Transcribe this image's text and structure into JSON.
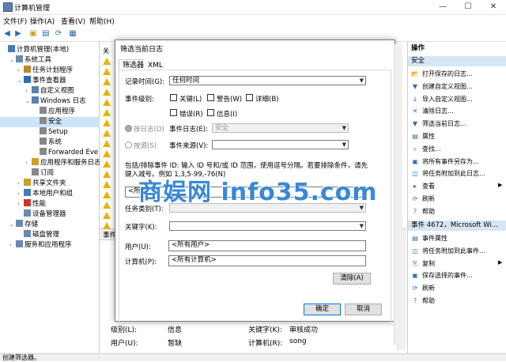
{
  "window": {
    "title": "计算机管理",
    "min": "—",
    "max": "☐",
    "close": "✕"
  },
  "menu": [
    "文件(F)",
    "操作(A)",
    "查看(V)",
    "帮助(H)"
  ],
  "tree": [
    {
      "label": "计算机管理(本地)",
      "indent": 0,
      "arrow": ""
    },
    {
      "label": "系统工具",
      "indent": 1,
      "arrow": "⌄"
    },
    {
      "label": "任务计划程序",
      "indent": 2,
      "arrow": "›"
    },
    {
      "label": "事件查看器",
      "indent": 2,
      "arrow": "⌄"
    },
    {
      "label": "自定义视图",
      "indent": 3,
      "arrow": "›"
    },
    {
      "label": "Windows 日志",
      "indent": 3,
      "arrow": "⌄"
    },
    {
      "label": "应用程序",
      "indent": 4,
      "arrow": ""
    },
    {
      "label": "安全",
      "indent": 4,
      "arrow": "",
      "selected": true
    },
    {
      "label": "Setup",
      "indent": 4,
      "arrow": ""
    },
    {
      "label": "系统",
      "indent": 4,
      "arrow": ""
    },
    {
      "label": "Forwarded Eve",
      "indent": 4,
      "arrow": ""
    },
    {
      "label": "应用程序和服务日志",
      "indent": 3,
      "arrow": "›"
    },
    {
      "label": "订阅",
      "indent": 3,
      "arrow": ""
    },
    {
      "label": "共享文件夹",
      "indent": 2,
      "arrow": "›"
    },
    {
      "label": "本地用户和组",
      "indent": 2,
      "arrow": "›"
    },
    {
      "label": "性能",
      "indent": 2,
      "arrow": "›"
    },
    {
      "label": "设备管理器",
      "indent": 2,
      "arrow": ""
    },
    {
      "label": "存储",
      "indent": 1,
      "arrow": "⌄"
    },
    {
      "label": "磁盘管理",
      "indent": 2,
      "arrow": ""
    },
    {
      "label": "服务和应用程序",
      "indent": 1,
      "arrow": "›"
    }
  ],
  "middle": {
    "col_header": "关",
    "event_pane_header": "事件",
    "details": {
      "level_label": "级别(L):",
      "level_value": "信息",
      "keyword_label": "关键字(K):",
      "keyword_value": "审核成功",
      "user_label": "用户(U):",
      "user_value": "暂缺",
      "computer_label": "计算机(R):",
      "computer_value": "song"
    }
  },
  "actions": {
    "header": "操作",
    "section1": "安全",
    "items1": [
      "打开保存的日志...",
      "创建自定义视图...",
      "导入自定义视图...",
      "清除日志...",
      "筛选当前日志...",
      "属性",
      "查找...",
      "将所有事件另存为...",
      "将任务附加到此日志...",
      "查看",
      "刷新",
      "帮助"
    ],
    "section2": "事件 4672，Microsoft Wi...",
    "items2": [
      "事件属性",
      "将任务附加到此事件...",
      "复制",
      "保存选择的事件...",
      "刷新",
      "帮助"
    ]
  },
  "dialog": {
    "title": "筛选当前日志",
    "tabs": [
      "筛选器",
      "XML"
    ],
    "logged_label": "记录时间(G):",
    "logged_value": "任何时间",
    "level_label": "事件级别:",
    "levels": [
      "关键(L)",
      "警告(W)",
      "详细(B)",
      "错误(R)",
      "信息(I)"
    ],
    "by_log_label": "按日志(O)",
    "event_log_label": "事件日志(E):",
    "event_log_value": "安全",
    "by_source_label": "按源(S)",
    "source_label": "事件来源(V):",
    "source_value": "",
    "id_hint": "包括/排除事件 ID: 输入 ID 号和/或 ID 范围，使用逗号分隔。若要排除条件，请先键入减号。例如 1,3,5-99,-76(N)",
    "id_value": "<所有",
    "task_label": "任务类别(T):",
    "keywords_label": "关键字(K):",
    "user_label": "用户(U):",
    "user_value": "<所有用户>",
    "computer_label": "计算机(P):",
    "computer_value": "<所有计算机>",
    "clear_button": "清除(A)",
    "ok_button": "确定",
    "cancel_button": "取消"
  },
  "watermark": "商娱网 info35.com",
  "status": "创建筛选器。",
  "colors": {
    "accent": "#0078d7",
    "selection": "#cce4f7",
    "watermark": "#2a7fd4"
  }
}
